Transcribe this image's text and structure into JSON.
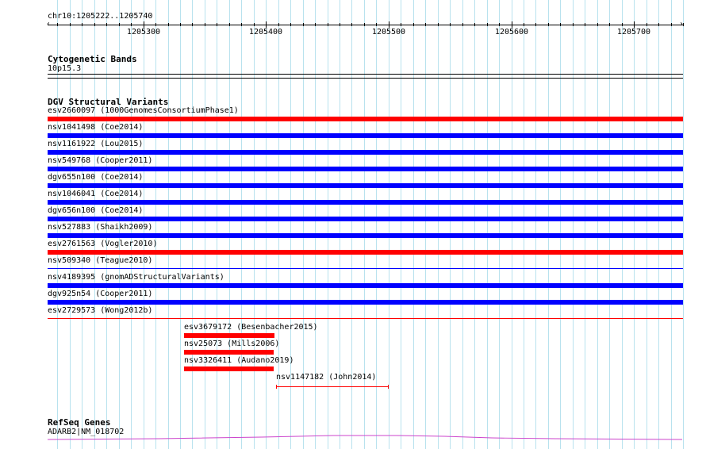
{
  "ruler": {
    "region": "chr10:1205222..1205740",
    "ticks": [
      {
        "pos": 1205300,
        "label": "1205300"
      },
      {
        "pos": 1205400,
        "label": "1205400"
      },
      {
        "pos": 1205500,
        "label": "1205500"
      },
      {
        "pos": 1205600,
        "label": "1205600"
      },
      {
        "pos": 1205700,
        "label": "1205700"
      }
    ],
    "start": 1205222,
    "end": 1205740
  },
  "cytoband": {
    "title": "Cytogenetic Bands",
    "band": "10p15.3"
  },
  "dgv": {
    "title": "DGV Structural Variants",
    "features": [
      {
        "name": "esv2660097 (1000GenomesConsortiumPhase1)",
        "color": "#ff0000",
        "start": 1205222,
        "end": 1205740
      },
      {
        "name": "nsv1041498 (Coe2014)",
        "color": "#0000ff",
        "start": 1205222,
        "end": 1205740
      },
      {
        "name": "nsv1161922 (Lou2015)",
        "color": "#0000ff",
        "start": 1205222,
        "end": 1205740
      },
      {
        "name": "nsv549768 (Cooper2011)",
        "color": "#0000ff",
        "start": 1205222,
        "end": 1205740
      },
      {
        "name": "dgv655n100 (Coe2014)",
        "color": "#0000ff",
        "start": 1205222,
        "end": 1205740
      },
      {
        "name": "nsv1046041 (Coe2014)",
        "color": "#0000ff",
        "start": 1205222,
        "end": 1205740
      },
      {
        "name": "dgv656n100 (Coe2014)",
        "color": "#0000ff",
        "start": 1205222,
        "end": 1205740
      },
      {
        "name": "nsv527883 (Shaikh2009)",
        "color": "#0000ff",
        "start": 1205222,
        "end": 1205740
      },
      {
        "name": "esv2761563 (Vogler2010)",
        "color": "#ff0000",
        "start": 1205222,
        "end": 1205740
      },
      {
        "name": "nsv509340 (Teague2010)",
        "color": "#0000ff",
        "start": 1205222,
        "end": 1205740,
        "thin": true
      },
      {
        "name": "nsv4189395 (gnomADStructuralVariants)",
        "color": "#0000ff",
        "start": 1205222,
        "end": 1205740
      },
      {
        "name": "dgv925n54 (Cooper2011)",
        "color": "#0000ff",
        "start": 1205222,
        "end": 1205740
      },
      {
        "name": "esv2729573 (Wong2012b)",
        "color": "#ff0000",
        "start": 1205222,
        "end": 1205740,
        "thin": true
      },
      {
        "name": "esv3679172 (Besenbacher2015)",
        "color": "#ff0000",
        "start": 1205333,
        "end": 1205407
      },
      {
        "name": "nsv25073 (Mills2006)",
        "color": "#ff0000",
        "start": 1205333,
        "end": 1205406
      },
      {
        "name": "nsv3326411 (Audano2019)",
        "color": "#ff0000",
        "start": 1205333,
        "end": 1205406
      },
      {
        "name": "nsv1147182 (John2014)",
        "color": "#ff0000",
        "start": 1205408,
        "end": 1205500,
        "interval": true
      }
    ]
  },
  "refseq": {
    "title": "RefSeq Genes",
    "gene": "ADARB2|NM_018702",
    "color": "#cc44cc"
  }
}
